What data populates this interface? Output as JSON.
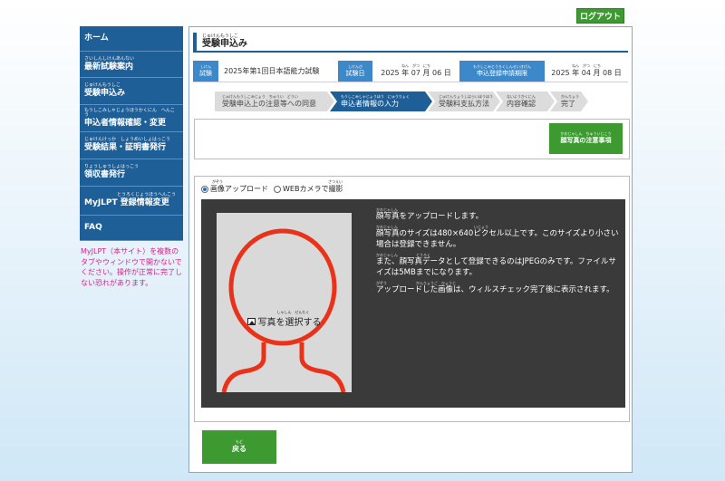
{
  "header": {
    "logout_label": "ログアウト"
  },
  "sidebar": {
    "items": [
      {
        "ruby": "",
        "label": "ホーム"
      },
      {
        "ruby": "さいしんしけんあんない",
        "label": "最新試験案内"
      },
      {
        "ruby": "じゅけんもうしこ",
        "label": "受験申込み"
      },
      {
        "ruby": "もうしこみしゃじょうほうかくにん　へんこう",
        "label": "申込者情報確認・変更"
      },
      {
        "ruby": "じゅけんけっか　しょうめいしょはっこう",
        "label": "受験結果・証明書発行"
      },
      {
        "ruby": "りょうしゅうしょはっこう",
        "label": "領収書発行"
      },
      {
        "ruby": "とうろくじょうほうへんこう",
        "label": "MyJLPT 登録情報変更"
      },
      {
        "ruby": "",
        "label": "FAQ"
      }
    ],
    "warning": "MyJLPT（本サイト）を複数のタブやウィンドウで開かないでください。操作が正常に完了しない恐れがあります。"
  },
  "page": {
    "title_ruby": "じゅけんもうしこ",
    "title": "受験申込み"
  },
  "exam_info": {
    "exam_label_ruby": "しけん",
    "exam_label": "試験",
    "exam_value": "2025年第1回日本語能力試験",
    "date_label_ruby": "しけんび",
    "date_label": "試験日",
    "date_ruby": "ねん　がつ　にち",
    "date_value": "2025 年 07 月 06 日",
    "deadline_label_ruby": "もうしこみとうろくしんせいきげん",
    "deadline_label": "申込登録申請期限",
    "deadline_ruby": "ねん　がつ　にち",
    "deadline_value": "2025 年 04 月 08 日"
  },
  "steps": [
    {
      "ruby": "じゅけんもうしこみじょう　ちゅうい　どうい",
      "label": "受験申込上の注意等への同意"
    },
    {
      "ruby": "もうしこみしゃじょうほう　にゅうりょく",
      "label": "申込者情報の入力"
    },
    {
      "ruby": "じゅけんりょうしはらいほうほう",
      "label": "受験料支払方法"
    },
    {
      "ruby": "ないようかくにん",
      "label": "内容確認"
    },
    {
      "ruby": "かんりょう",
      "label": "完了"
    }
  ],
  "notice_button": {
    "ruby": "かおじゃしん　ちゅういじこう",
    "label": "顔写真の注意事項"
  },
  "upload": {
    "option_upload_ruby": "がぞう",
    "option_upload": "画像アップロード",
    "option_webcam_ruby": "さつえい",
    "option_webcam": "WEBカメラで撮影",
    "select_ruby": "しゃしん　せんたく",
    "select_label": "写真を選択する",
    "instructions": [
      {
        "ruby": "かおじゃしん",
        "text": "顔写真をアップロードします。"
      },
      {
        "ruby": "かおじゃしん　　　　　　　　　　　　　　　　　　　　　いじょう",
        "text": "顔写真のサイズは480×640ピクセル以上です。このサイズより小さい場合は登録できません。"
      },
      {
        "ruby": "かおじゃしん　　　　　とうろく",
        "text": "また、顔写真データとして登録できるのはJPEGのみです。ファイルサイズは5MBまでになります。"
      },
      {
        "ruby": "がぞう　　　　　　　　かんりょうご　ひょうじ",
        "text": "アップロードした画像は、ウィルスチェック完了後に表示されます。"
      }
    ]
  },
  "footer": {
    "back_ruby": "もど",
    "back_label": "戻る"
  },
  "colors": {
    "nav": "#1f5f97",
    "accent_green": "#3c9a31",
    "warning_text": "#d61f8a",
    "outline_red": "#e8321a"
  }
}
